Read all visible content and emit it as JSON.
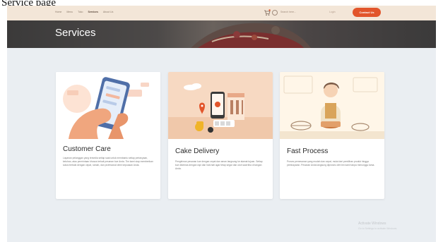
{
  "caption": "Service page",
  "navbar": {
    "links": [
      "Home",
      "Menu",
      "Toko",
      "Services",
      "About Us"
    ],
    "search_placeholder": "Search here...",
    "login": "Login",
    "contact_button": "Contact Us"
  },
  "hero": {
    "title": "Services"
  },
  "cards": [
    {
      "title": "Customer Care",
      "text": "Layanan pelanggan yang tersedia setiap saat untuk membantu setiap pertanyaan, keluhan, atau permintaan khusus terkait pesanan kue Anda. Tim kami siap memberikan solusi terbaik dengan cepat, ramah, dan profesional demi kepuasan Anda."
    },
    {
      "title": "Cake Delivery",
      "text": "Pengiriman pesanan kue dengan cepat dan aman langsung ke alamat tujuan. Setiap kue dikemas dengan rapi dan hati-hati agar tetap segar dan utuh saat tiba di tangan Anda."
    },
    {
      "title": "Fast Process",
      "text": "Proses pemesanan yang mudah dan cepat, mulai dari pemilihan produk hingga pembayaran. Pesanan Anda langsung diproses oleh tim kami tanpa menunggu lama."
    }
  ],
  "watermark": {
    "title": "Activate Windows",
    "subtitle": "Go to Settings to activate Windows."
  },
  "colors": {
    "accent": "#e2552b",
    "navbar_bg": "#f3e6d8",
    "page_bg": "#eaeef2"
  }
}
